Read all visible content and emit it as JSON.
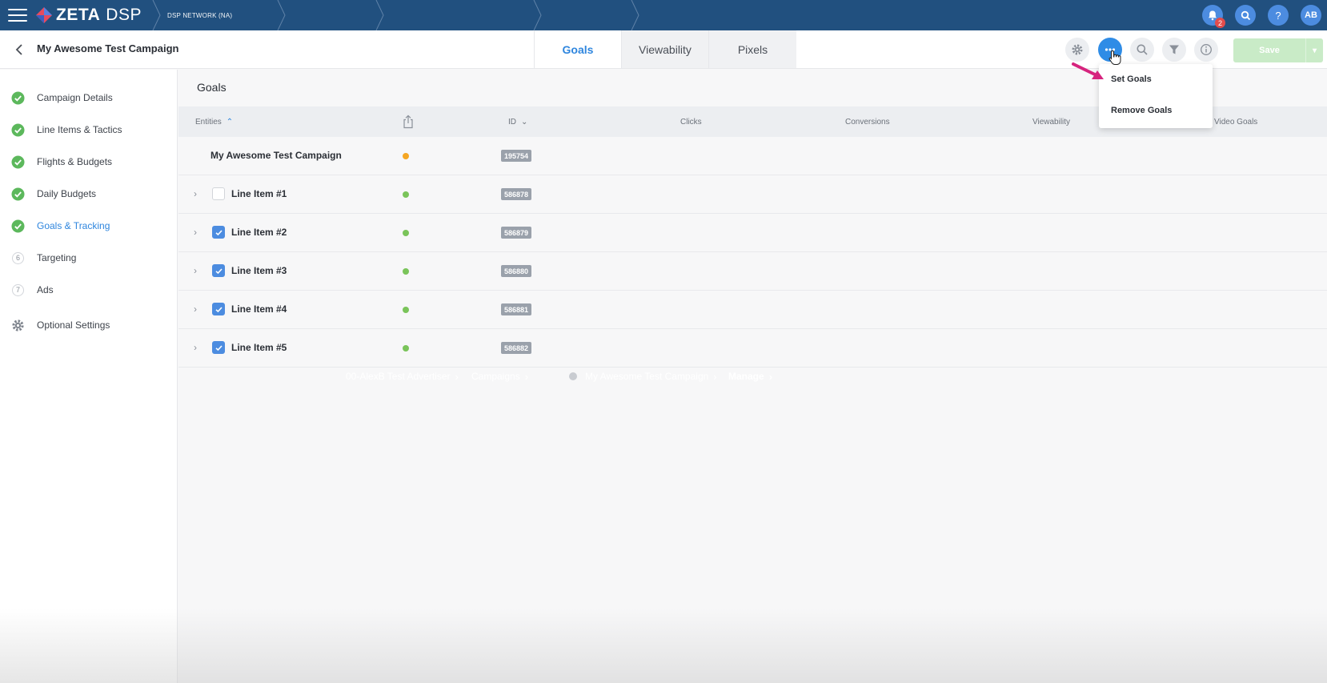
{
  "topbar": {
    "logo_text": "ZETA",
    "logo_sub": "DSP",
    "network_label": "DSP NETWORK (NA)",
    "advertiser": "00-AlexB Test Advertiser",
    "crumb_campaigns": "Campaigns",
    "crumb_campaign": "My Awesome Test Campaign",
    "crumb_manage": "Manage",
    "notification_count": "2",
    "avatar_initials": "AB",
    "help_glyph": "?",
    "colors": {
      "bar": "#21507f",
      "icon_bg": "#4c8ce0",
      "badge": "#e24c4c"
    }
  },
  "subheader": {
    "title": "My Awesome Test Campaign",
    "tabs": [
      {
        "label": "Goals",
        "active": true
      },
      {
        "label": "Viewability",
        "active": false
      },
      {
        "label": "Pixels",
        "active": false
      }
    ],
    "save_label": "Save",
    "tools": [
      "gear-icon",
      "more-icon",
      "search-icon",
      "filter-icon",
      "info-icon"
    ]
  },
  "sidebar": {
    "items": [
      {
        "label": "Campaign Details",
        "state": "done"
      },
      {
        "label": "Line Items & Tactics",
        "state": "done"
      },
      {
        "label": "Flights & Budgets",
        "state": "done"
      },
      {
        "label": "Daily Budgets",
        "state": "done"
      },
      {
        "label": "Goals & Tracking",
        "state": "done",
        "active": true
      },
      {
        "label": "Targeting",
        "state": "step",
        "step": "6"
      },
      {
        "label": "Ads",
        "state": "step",
        "step": "7"
      },
      {
        "label": "Optional Settings",
        "state": "settings"
      }
    ]
  },
  "main": {
    "section_title": "Goals",
    "columns": {
      "entities": "Entities",
      "id": "ID",
      "clicks": "Clicks",
      "conversions": "Conversions",
      "viewability": "Viewability",
      "video_goals": "Video Goals"
    },
    "rows": [
      {
        "name": "My Awesome Test Campaign",
        "id": "195754",
        "status_color": "#f5a623",
        "type": "campaign"
      },
      {
        "name": "Line Item #1",
        "id": "586878",
        "status_color": "#7ac45a",
        "checked": false
      },
      {
        "name": "Line Item #2",
        "id": "586879",
        "status_color": "#7ac45a",
        "checked": true
      },
      {
        "name": "Line Item #3",
        "id": "586880",
        "status_color": "#7ac45a",
        "checked": true
      },
      {
        "name": "Line Item #4",
        "id": "586881",
        "status_color": "#7ac45a",
        "checked": true
      },
      {
        "name": "Line Item #5",
        "id": "586882",
        "status_color": "#7ac45a",
        "checked": true
      }
    ]
  },
  "dropdown": {
    "items": [
      {
        "label": "Set Goals"
      },
      {
        "label": "Remove Goals"
      }
    ]
  }
}
